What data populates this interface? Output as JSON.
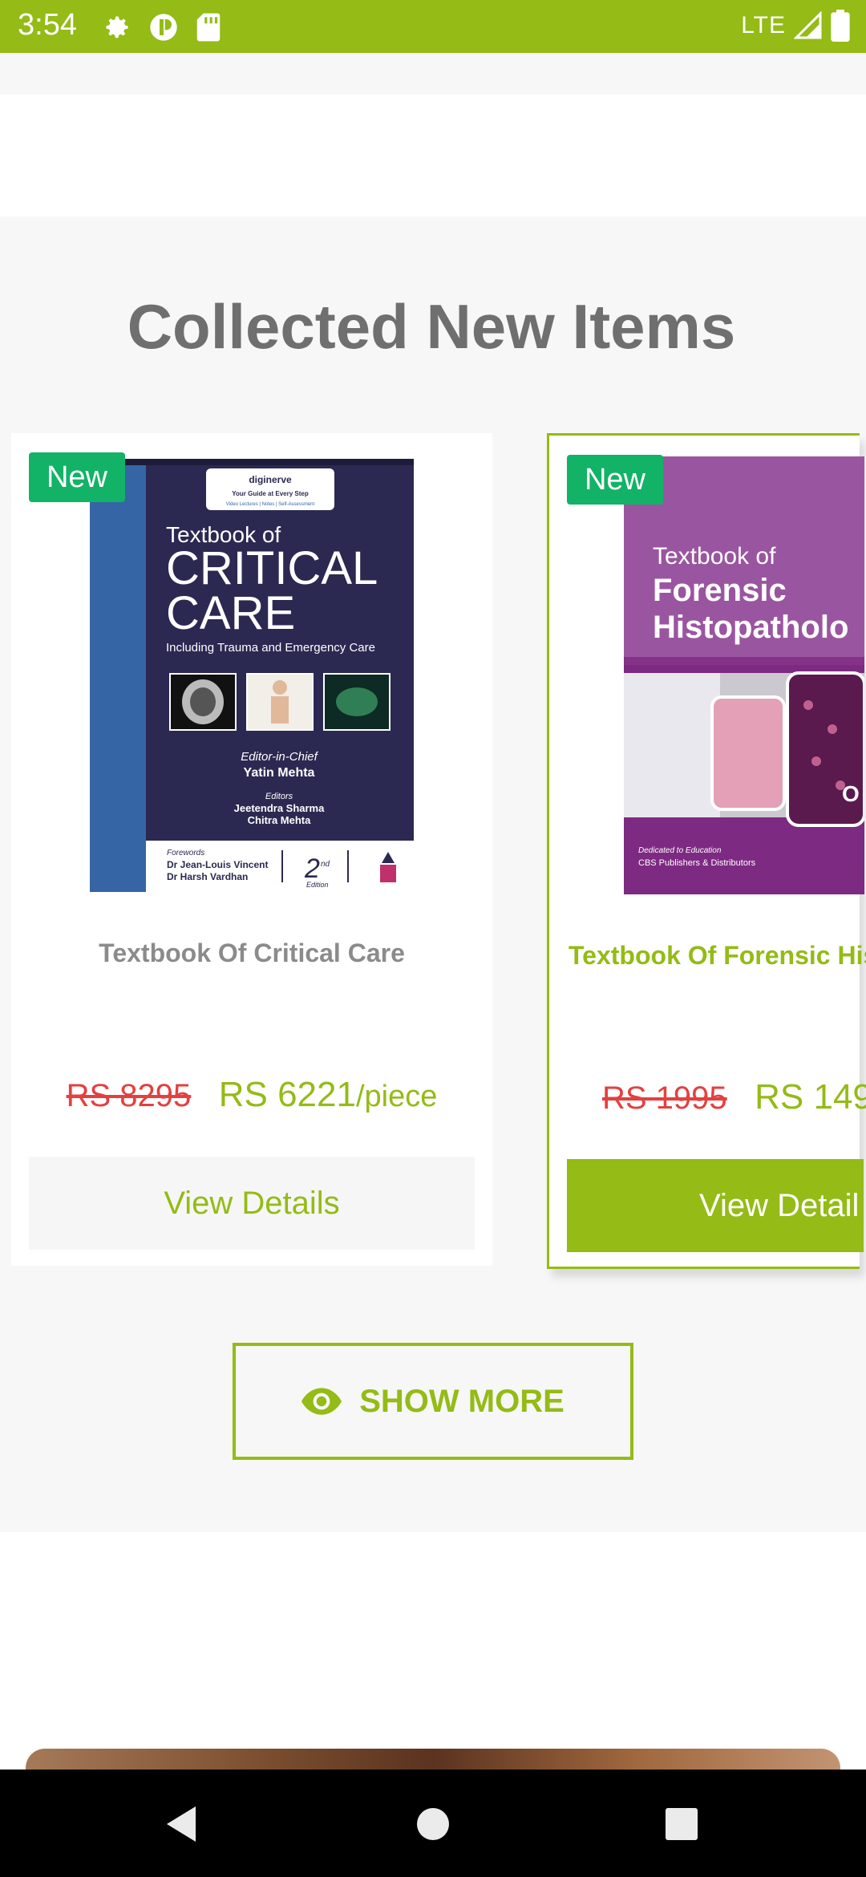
{
  "status_bar": {
    "time": "3:54",
    "network": "LTE",
    "icons": [
      "settings-gear-icon",
      "data-saver-icon",
      "sd-card-icon",
      "signal-icon",
      "battery-icon"
    ],
    "color": "#94bb16"
  },
  "section": {
    "title": "Collected New Items"
  },
  "products": [
    {
      "badge": "New",
      "title": "Textbook Of Critical Care",
      "old_price": "RS 8295",
      "new_price": "RS 6221",
      "unit": "/piece",
      "button": "View Details",
      "cover": {
        "publisher_line": "diginerve",
        "tagline": "Your Guide at Every Step",
        "tagline2": "Video Lectures | Notes | Self-Assessment",
        "heading_small": "Textbook of",
        "heading_1": "CRITICAL",
        "heading_2": "CARE",
        "subtitle": "Including Trauma and Emergency Care",
        "editor_label": "Editor-in-Chief",
        "editor": "Yatin Mehta",
        "editors_label": "Editors",
        "editor_2": "Jeetendra Sharma",
        "editor_3": "Chitra Mehta",
        "forewords_label": "Forewords",
        "foreword_1": "Dr Jean-Louis Vincent",
        "foreword_2": "Dr Harsh Vardhan",
        "edition_num": "2",
        "edition_sup": "nd",
        "edition_label": "Edition"
      }
    },
    {
      "badge": "New",
      "title": "Textbook Of Forensic His",
      "old_price": "RS 1995",
      "new_price": "RS 149",
      "unit": "",
      "button": "View Detail",
      "cover": {
        "heading_small": "Textbook of",
        "heading_1": "Forensic",
        "heading_2": "Histopatholo",
        "publisher": "CBS Publishers & Distributors",
        "publisher_tag": "Dedicated to Education",
        "corner": "O"
      }
    }
  ],
  "show_more": {
    "label": "SHOW MORE",
    "icon": "eye-icon"
  },
  "colors": {
    "accent": "#94bb16",
    "badge": "#12b366",
    "old_price": "#e44040"
  }
}
